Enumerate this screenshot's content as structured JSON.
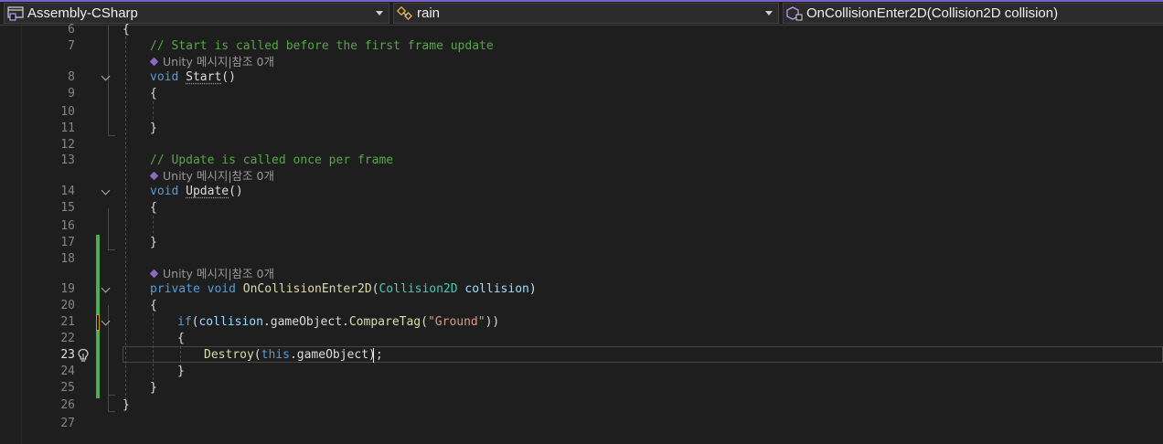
{
  "navbar": {
    "project": "Assembly-CSharp",
    "class": "rain",
    "member": "OnCollisionEnter2D(Collision2D collision)"
  },
  "editor": {
    "codelens": "Unity 메시지|참조 0개",
    "lines": [
      {
        "n": "6"
      },
      {
        "n": "7"
      },
      {
        "n": "8"
      },
      {
        "n": "9"
      },
      {
        "n": "10"
      },
      {
        "n": "11"
      },
      {
        "n": "12"
      },
      {
        "n": "13"
      },
      {
        "n": "14"
      },
      {
        "n": "15"
      },
      {
        "n": "16"
      },
      {
        "n": "17"
      },
      {
        "n": "18"
      },
      {
        "n": "19"
      },
      {
        "n": "20"
      },
      {
        "n": "21"
      },
      {
        "n": "22"
      },
      {
        "n": "23"
      },
      {
        "n": "24"
      },
      {
        "n": "25"
      },
      {
        "n": "26"
      },
      {
        "n": "27"
      }
    ],
    "tokens": {
      "l6": "{",
      "l7": "// Start is called before the first frame update",
      "l8_kw": "void",
      "l8_fn": "Start",
      "l8_p": "()",
      "l9": "{",
      "l11": "}",
      "l13": "// Update is called once per frame",
      "l14_kw": "void",
      "l14_fn": "Update",
      "l14_p": "()",
      "l15": "{",
      "l17": "}",
      "l19_kw1": "private",
      "l19_kw2": "void",
      "l19_fn": "OnCollisionEnter2D",
      "l19_p1": "(",
      "l19_ty": "Collision2D",
      "l19_pr": "collision",
      "l19_p2": ")",
      "l20": "{",
      "l21_kw": "if",
      "l21_a": "(",
      "l21_pr": "collision",
      "l21_b": ".gameObject.",
      "l21_mt": "CompareTag",
      "l21_c": "(",
      "l21_st": "\"Ground\"",
      "l21_d": "))",
      "l22": "{",
      "l23_mt": "Destroy",
      "l23_a": "(",
      "l23_kw": "this",
      "l23_b": ".gameObject);",
      "l24": "}",
      "l25": "}",
      "l26": "}"
    }
  }
}
